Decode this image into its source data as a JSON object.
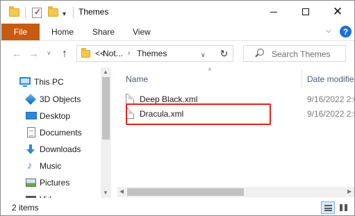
{
  "window": {
    "title": "Themes"
  },
  "ribbon": {
    "file_tab": "File",
    "tabs": [
      "Home",
      "Share",
      "View"
    ],
    "help_glyph": "?"
  },
  "address": {
    "crumb_overflow": "<<",
    "crumbs": [
      "Not...",
      "Themes"
    ],
    "search_placeholder": "Search Themes"
  },
  "nav_pane": {
    "items": [
      {
        "label": "This PC",
        "icon": "computer-icon"
      },
      {
        "label": "3D Objects",
        "icon": "3d-objects-icon"
      },
      {
        "label": "Desktop",
        "icon": "desktop-icon"
      },
      {
        "label": "Documents",
        "icon": "documents-icon"
      },
      {
        "label": "Downloads",
        "icon": "downloads-icon"
      },
      {
        "label": "Music",
        "icon": "music-icon"
      },
      {
        "label": "Pictures",
        "icon": "pictures-icon"
      },
      {
        "label": "Vid",
        "icon": "videos-icon"
      }
    ]
  },
  "file_list": {
    "columns": {
      "name": "Name",
      "date": "Date modifie"
    },
    "files": [
      {
        "name": "Deep Black.xml",
        "date": "9/16/2022 2:0"
      },
      {
        "name": "Dracula.xml",
        "date": "9/16/2022 2:5"
      }
    ],
    "highlighted": "Dracula.xml"
  },
  "status": {
    "items_count": "2 items"
  },
  "colors": {
    "accent": "#c75b12",
    "highlight": "#e02020",
    "help": "#1e6fd6"
  }
}
